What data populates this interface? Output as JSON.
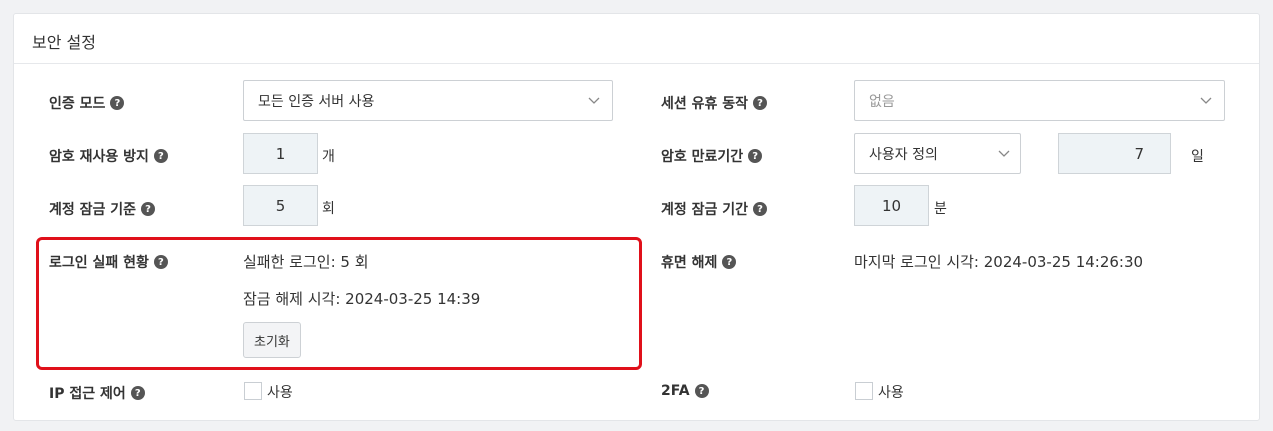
{
  "panel": {
    "title": "보안 설정"
  },
  "auth_mode": {
    "label": "인증 모드",
    "value": "모든 인증 서버 사용"
  },
  "session_action": {
    "label": "세션 유휴 동작",
    "value": "없음"
  },
  "password_reuse": {
    "label": "암호 재사용 방지",
    "value": "1",
    "unit": "개"
  },
  "password_expiry": {
    "label": "암호 만료기간",
    "select_value": "사용자 정의",
    "value": "7",
    "unit": "일"
  },
  "lock_threshold": {
    "label": "계정 잠금 기준",
    "value": "5",
    "unit": "회"
  },
  "lock_duration": {
    "label": "계정 잠금 기간",
    "value": "10",
    "unit": "분"
  },
  "login_failure": {
    "label": "로그인 실패 현황",
    "failed_text": "실패한 로그인: 5 회",
    "unlock_text": "잠금 해제 시각: 2024-03-25 14:39",
    "reset_label": "초기화"
  },
  "dormancy": {
    "label": "휴면 해제",
    "last_login_text": "마지막 로그인 시각: 2024-03-25 14:26:30"
  },
  "ip_control": {
    "label": "IP 접근 제어",
    "checkbox_label": "사용"
  },
  "twofa": {
    "label": "2FA",
    "checkbox_label": "사용"
  },
  "icons": {
    "help": "question-circle-icon",
    "dropdown": "chevron-down-icon"
  },
  "colors": {
    "highlight": "#e0101a",
    "input_bg": "#eef3f6"
  }
}
